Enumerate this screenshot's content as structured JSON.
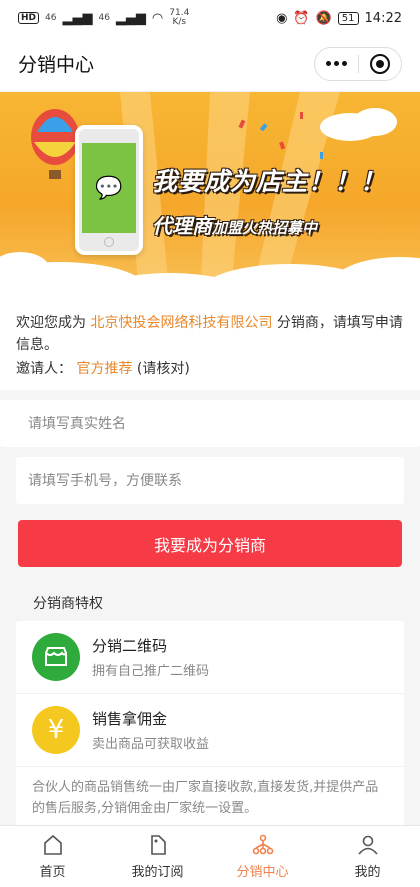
{
  "status_bar": {
    "hd": "HD",
    "net_small": "46",
    "net_speed": "71.4",
    "net_unit": "K/s",
    "battery": "51",
    "time": "14:22"
  },
  "nav": {
    "title": "分销中心"
  },
  "banner": {
    "line1": "我要成为店主！！！",
    "line2_big": "代理商",
    "line2_small": "加盟火热招募中"
  },
  "intro": {
    "prefix": "欢迎您成为",
    "company": "北京快投会网络科技有限公司",
    "suffix": "分销商，请填写申请信息。",
    "inviter_label": "邀请人：",
    "inviter_value": "官方推荐",
    "inviter_note": "(请核对)"
  },
  "form": {
    "name_placeholder": "请填写真实姓名",
    "phone_placeholder": "请填写手机号，方便联系",
    "submit_label": "我要成为分销商"
  },
  "privileges": {
    "title": "分销商特权",
    "items": [
      {
        "name": "分销二维码",
        "desc": "拥有自己推广二维码",
        "icon": "shop-icon",
        "color": "#2eab3b"
      },
      {
        "name": "销售拿佣金",
        "desc": "卖出商品可获取收益",
        "icon": "yen-icon",
        "color": "#f5c81f"
      }
    ],
    "note": "合伙人的商品销售统一由厂家直接收款,直接发货,并提供产品的售后服务,分销佣金由厂家统一设置。"
  },
  "tabbar": {
    "items": [
      {
        "label": "首页",
        "icon": "home-icon",
        "active": false
      },
      {
        "label": "我的订阅",
        "icon": "tag-icon",
        "active": false
      },
      {
        "label": "分销中心",
        "icon": "network-icon",
        "active": true
      },
      {
        "label": "我的",
        "icon": "user-icon",
        "active": false
      }
    ]
  },
  "colors": {
    "accent": "#e8882b",
    "primary": "#f63b47",
    "active_tab": "#f0834d"
  }
}
